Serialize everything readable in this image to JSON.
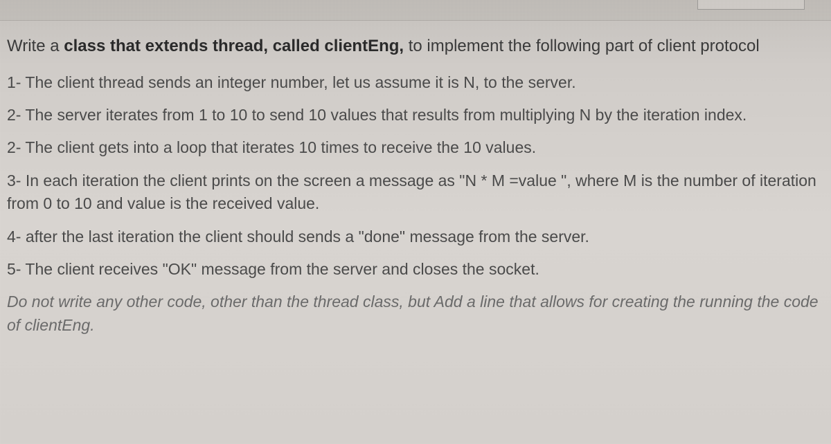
{
  "intro": {
    "prefix": "Write a ",
    "bold": "class that extends thread, called clientEng,",
    "suffix": " to implement the following part of client protocol"
  },
  "steps": [
    "1- The client thread sends an integer number, let us assume it is N, to the server.",
    "2- The server iterates from 1 to 10 to send 10 values that results from multiplying N by the iteration index.",
    "2- The client gets into a loop that iterates 10 times to receive the 10 values.",
    "3- In each iteration the client prints on the screen a message as \"N * M =value \", where M is the number of iteration from 0 to 10 and value is the received value.",
    "4- after the last iteration the client should sends a \"done\" message from the server.",
    "5- The client receives \"OK\" message from the server and closes the socket."
  ],
  "footnote": "Do not write any other code, other than the thread class, but Add a line that allows for creating the running the code of clientEng."
}
